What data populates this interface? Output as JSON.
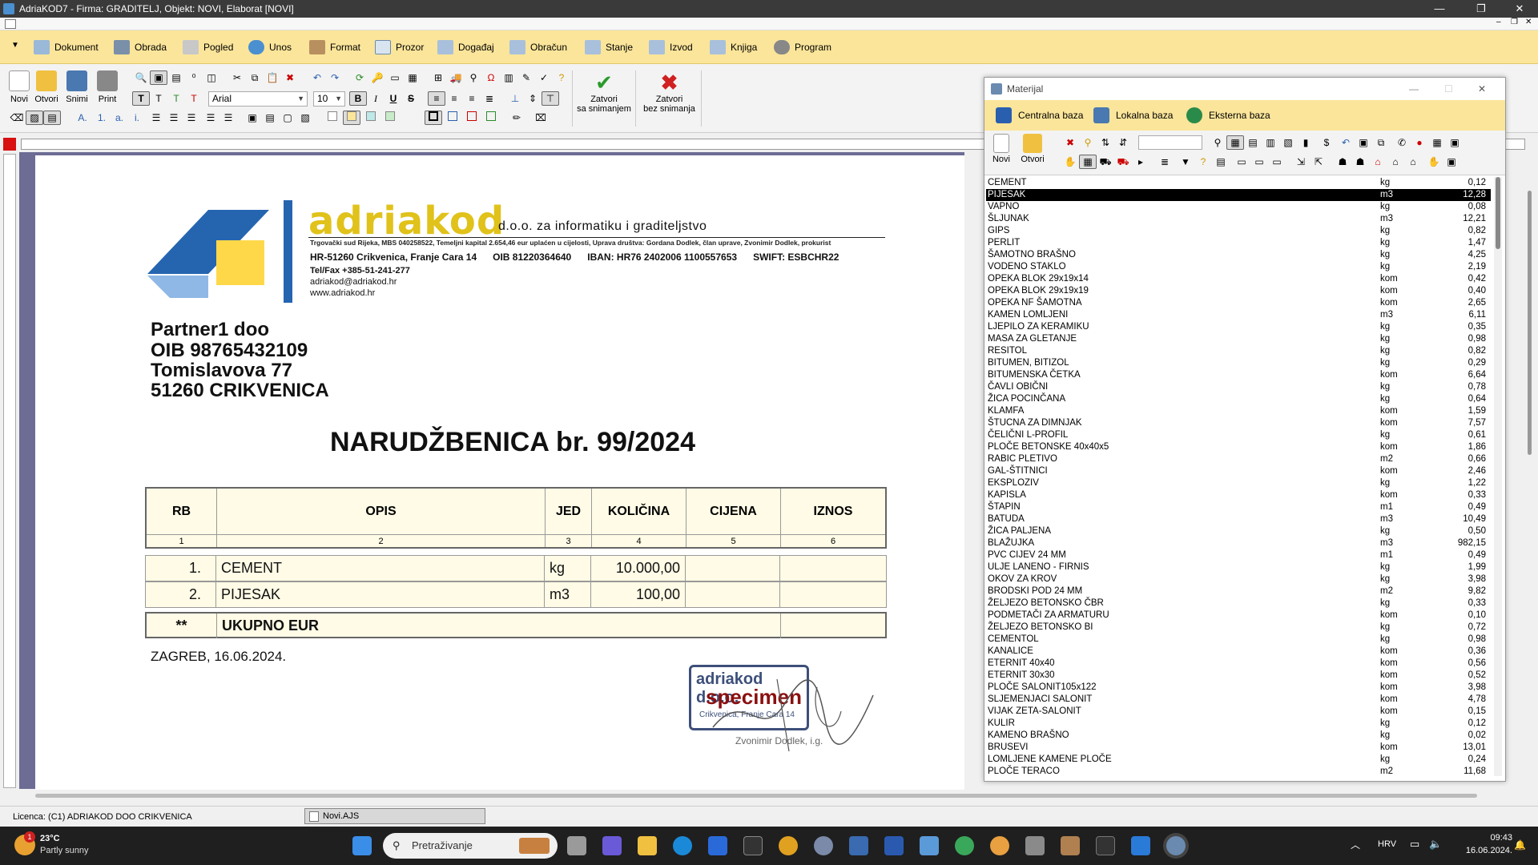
{
  "window": {
    "title": "AdriaKOD7 - Firma: GRADITELJ,   Objekt: NOVI,  Elaborat [NOVI]",
    "min": "—",
    "max": "❐",
    "close": "✕"
  },
  "menu": {
    "arrow": "▼",
    "items": [
      "Dokument",
      "Obrada",
      "Pogled",
      "Unos",
      "Format",
      "Prozor",
      "Događaj",
      "Obračun",
      "Stanje",
      "Izvod",
      "Knjiga",
      "Program"
    ]
  },
  "toolbar": {
    "new": "Novi",
    "open": "Otvori",
    "save": "Snimi",
    "print": "Print",
    "font": "Arial",
    "size": "10",
    "close_save_1": "Zatvori",
    "close_save_2": "sa snimanjem",
    "close_nosave_1": "Zatvori",
    "close_nosave_2": "bez snimanja",
    "bold": "B",
    "italic": "I",
    "underline": "U",
    "strike": "S"
  },
  "letterhead": {
    "brand": "adriakod",
    "subtitle": "d.o.o. za informatiku i graditeljstvo",
    "registry": "Trgovački sud Rijeka, MBS 040258522, Temeljni kapital  2.654,46 eur uplaćen u cijelosti, Uprava društva: Gordana Dodlek, član uprave, Zvonimir Dodlek, prokurist",
    "address": "HR-51260 Crikvenica, Franje Cara 14",
    "oib": "OIB 81220364640",
    "iban": "IBAN: HR76 2402006 1100557653",
    "swift": "SWIFT: ESBCHR22",
    "tel": "Tel/Fax +385-51-241-277",
    "email": "adriakod@adriakod.hr",
    "web": "www.adriakod.hr"
  },
  "partner": {
    "name": "Partner1 doo",
    "oib": "OIB 98765432109",
    "street": "Tomislavova 77",
    "city": "51260 CRIKVENICA"
  },
  "document": {
    "title": "NARUDŽBENICA br. 99/2024",
    "headers": [
      "RB",
      "OPIS",
      "JED",
      "KOLIČINA",
      "CIJENA",
      "IZNOS"
    ],
    "col_numbers": [
      "1",
      "2",
      "3",
      "4",
      "5",
      "6"
    ],
    "rows": [
      {
        "rb": "1.",
        "opis": "CEMENT",
        "jed": "kg",
        "kol": "10.000,00"
      },
      {
        "rb": "2.",
        "opis": "PIJESAK",
        "jed": "m3",
        "kol": "100,00"
      }
    ],
    "total_mark": "**",
    "total_label": "UKUPNO EUR",
    "place_date": "ZAGREB, 16.06.2024.",
    "stamp_top": "adriakod d.o.o.",
    "stamp_mid": "specimen",
    "stamp_small": "Crikvenica, Franje Cara 14",
    "signature": "Zvonimir Dodlek, i.g."
  },
  "panel": {
    "title": "Materijal",
    "bases": [
      "Centralna baza",
      "Lokalna baza",
      "Eksterna baza"
    ],
    "new": "Novi",
    "open": "Otvori",
    "selected_index": 1,
    "items": [
      [
        "CEMENT",
        "kg",
        "0,12"
      ],
      [
        "PIJESAK",
        "m3",
        "12,28"
      ],
      [
        "VAPNO",
        "kg",
        "0,08"
      ],
      [
        "ŠLJUNAK",
        "m3",
        "12,21"
      ],
      [
        "GIPS",
        "kg",
        "0,82"
      ],
      [
        "PERLIT",
        "kg",
        "1,47"
      ],
      [
        "ŠAMOTNO BRAŠNO",
        "kg",
        "4,25"
      ],
      [
        "VODENO STAKLO",
        "kg",
        "2,19"
      ],
      [
        "OPEKA BLOK 29x19x14",
        "kom",
        "0,42"
      ],
      [
        "OPEKA BLOK 29x19x19",
        "kom",
        "0,40"
      ],
      [
        "OPEKA NF ŠAMOTNA",
        "kom",
        "2,65"
      ],
      [
        "KAMEN LOMLJENI",
        "m3",
        "6,11"
      ],
      [
        "LJEPILO ZA KERAMIKU",
        "kg",
        "0,35"
      ],
      [
        "MASA ZA GLETANJE",
        "kg",
        "0,98"
      ],
      [
        "RESITOL",
        "kg",
        "0,82"
      ],
      [
        "BITUMEN, BITIZOL",
        "kg",
        "0,29"
      ],
      [
        "BITUMENSKA ČETKA",
        "kom",
        "6,64"
      ],
      [
        "ČAVLI OBIČNI",
        "kg",
        "0,78"
      ],
      [
        "ŽICA POCINČANA",
        "kg",
        "0,64"
      ],
      [
        "KLAMFA",
        "kom",
        "1,59"
      ],
      [
        "ŠTUCNA ZA DIMNJAK",
        "kom",
        "7,57"
      ],
      [
        "ČELIČNI L-PROFIL",
        "kg",
        "0,61"
      ],
      [
        "PLOČE BETONSKE 40x40x5",
        "kom",
        "1,86"
      ],
      [
        "RABIC PLETIVO",
        "m2",
        "0,66"
      ],
      [
        "GAL-ŠTITNICI",
        "kom",
        "2,46"
      ],
      [
        "EKSPLOZIV",
        "kg",
        "1,22"
      ],
      [
        "KAPISLA",
        "kom",
        "0,33"
      ],
      [
        "ŠTAPIN",
        "m1",
        "0,49"
      ],
      [
        "BATUDA",
        "m3",
        "10,49"
      ],
      [
        "ŽICA PALJENA",
        "kg",
        "0,50"
      ],
      [
        "BLAŽUJKA",
        "m3",
        "982,15"
      ],
      [
        "PVC CIJEV 24 MM",
        "m1",
        "0,49"
      ],
      [
        "ULJE LANENO - FIRNIS",
        "kg",
        "1,99"
      ],
      [
        "OKOV ZA KROV",
        "kg",
        "3,98"
      ],
      [
        "BRODSKI POD 24 MM",
        "m2",
        "9,82"
      ],
      [
        "ŽELJEZO BETONSKO ČBR",
        "kg",
        "0,33"
      ],
      [
        "PODMETAČI ZA ARMATURU",
        "kom",
        "0,10"
      ],
      [
        "ŽELJEZO BETONSKO BI",
        "kg",
        "0,72"
      ],
      [
        "CEMENTOL",
        "kg",
        "0,98"
      ],
      [
        "KANALICE",
        "kom",
        "0,36"
      ],
      [
        "ETERNIT 40x40",
        "kom",
        "0,56"
      ],
      [
        "ETERNIT 30x30",
        "kom",
        "0,52"
      ],
      [
        "PLOČE SALONIT105x122",
        "kom",
        "3,98"
      ],
      [
        "SLJEMENJACI SALONIT",
        "kom",
        "4,78"
      ],
      [
        "VIJAK ZETA-SALONIT",
        "kom",
        "0,15"
      ],
      [
        "KULIR",
        "kg",
        "0,12"
      ],
      [
        "KAMENO BRAŠNO",
        "kg",
        "0,02"
      ],
      [
        "BRUSEVI",
        "kom",
        "13,01"
      ],
      [
        "LOMLJENE KAMENE PLOČE",
        "kg",
        "0,24"
      ],
      [
        "PLOČE TERACO",
        "m2",
        "11,68"
      ]
    ]
  },
  "status": {
    "license": "Licenca:  (C1) ADRIAKOD DOO CRIKVENICA",
    "doc_tab": "Novi.AJS"
  },
  "taskbar": {
    "weather_temp": "23°C",
    "weather_desc": "Partly sunny",
    "badge": "1",
    "search_placeholder": "Pretraživanje",
    "lang": "HRV",
    "time": "09:43",
    "date": "16.06.2024."
  },
  "colors": {
    "menubar": "#fbe59a",
    "brand_yellow": "#e0c21a",
    "brand_blue": "#2565b0",
    "doc_bg": "#6c6c94"
  }
}
